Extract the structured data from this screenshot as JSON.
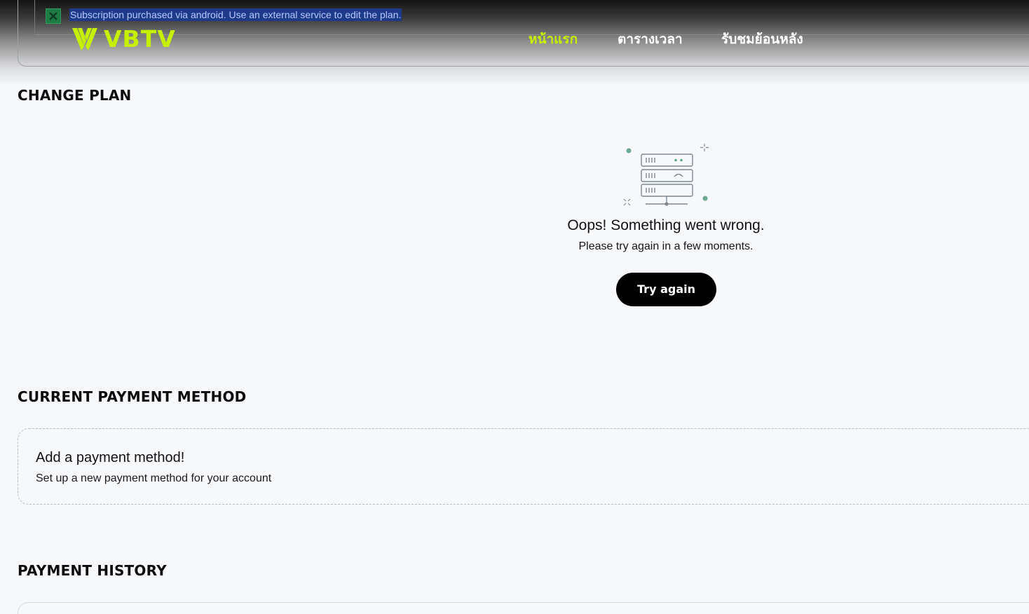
{
  "notice": {
    "text": "Subscription purchased via android. Use an external service to edit the plan.",
    "icon": "excel-close-icon"
  },
  "brand": {
    "name": "VBTV",
    "accent_color": "#c5f000"
  },
  "nav": {
    "items": [
      {
        "label": "หน้าแรก",
        "active": true
      },
      {
        "label": "ตารางเวลา",
        "active": false
      },
      {
        "label": "รับชมย้อนหลัง",
        "active": false
      }
    ]
  },
  "change_plan": {
    "title": "CHANGE PLAN",
    "error": {
      "icon": "server-error-icon",
      "title": "Oops! Something went wrong.",
      "message": "Please try again in a few moments.",
      "button": "Try again"
    }
  },
  "payment_method": {
    "title": "CURRENT PAYMENT METHOD",
    "card_title": "Add a payment method!",
    "card_subtitle": "Set up a new payment method for your account"
  },
  "payment_history": {
    "title": "PAYMENT HISTORY"
  }
}
